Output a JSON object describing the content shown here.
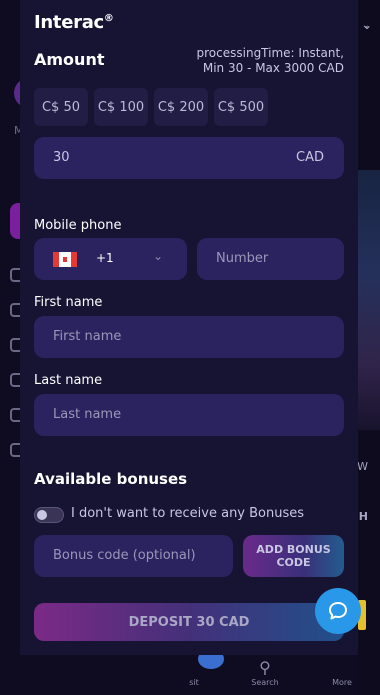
{
  "modal": {
    "title": "Interac",
    "title_mark": "®",
    "amount_heading": "Amount",
    "processing_line1": "processingTime: Instant,",
    "processing_line2": "Min 30 - Max 3000 CAD",
    "presets": [
      "C$ 50",
      "C$ 100",
      "C$ 200",
      "C$ 500"
    ],
    "amount_value": "30",
    "currency": "CAD",
    "mobile_label": "Mobile phone",
    "country_code": "+1",
    "number_placeholder": "Number",
    "first_name_label": "First name",
    "first_name_placeholder": "First name",
    "last_name_label": "Last name",
    "last_name_placeholder": "Last name",
    "bonuses_heading": "Available bonuses",
    "no_bonus_text": "I don't want to receive any Bonuses",
    "bonus_code_placeholder": "Bonus code (optional)",
    "add_bonus_label": "ADD BONUS CODE",
    "deposit_label": "DEPOSIT 30 CAD"
  },
  "background": {
    "left_letter": "M",
    "right_letter_w": "W",
    "right_letter_h": "H",
    "nav": [
      {
        "label": "sit"
      },
      {
        "label": "Search"
      },
      {
        "label": "More"
      }
    ]
  },
  "colors": {
    "modal_bg": "#171333",
    "input_bg": "#2a2360",
    "accent_blue": "#2a98e8"
  }
}
